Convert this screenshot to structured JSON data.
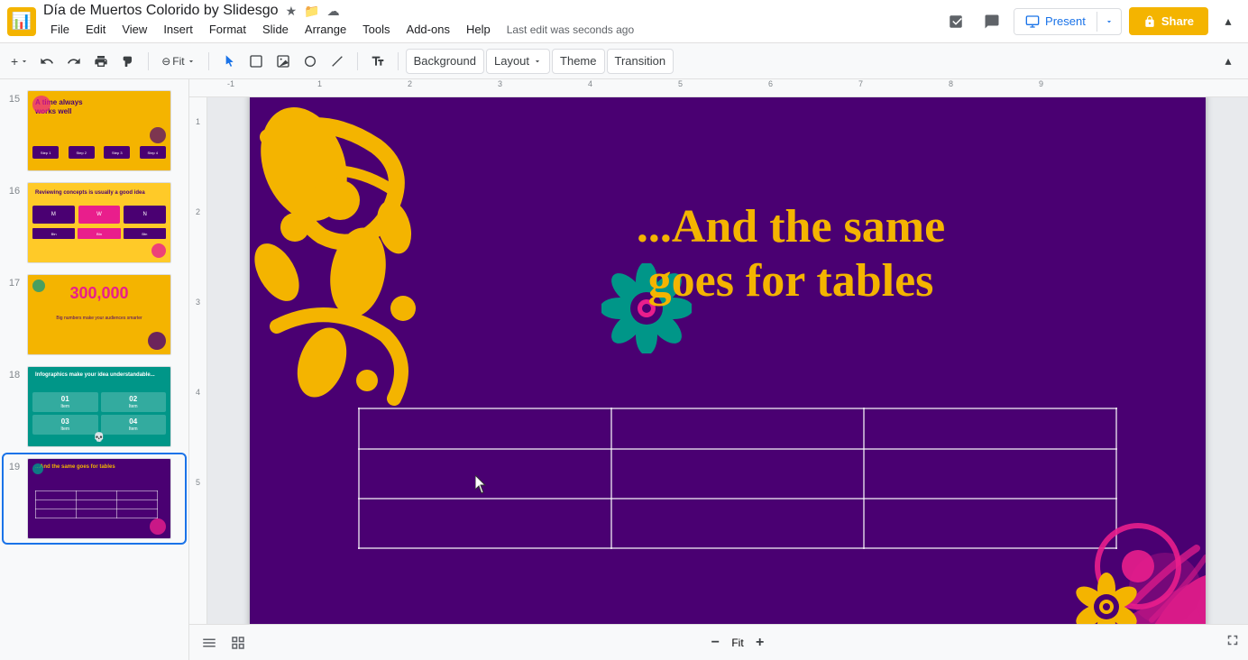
{
  "app": {
    "icon": "📊",
    "title": "Día de Muertos Colorido by Slidesgo",
    "last_edit": "Last edit was seconds ago"
  },
  "menu": {
    "items": [
      "File",
      "Edit",
      "View",
      "Insert",
      "Format",
      "Slide",
      "Arrange",
      "Tools",
      "Add-ons",
      "Help"
    ]
  },
  "toolbar": {
    "background_label": "Background",
    "layout_label": "Layout",
    "theme_label": "Theme",
    "transition_label": "Transition"
  },
  "present": {
    "label": "Present"
  },
  "share": {
    "label": "Share"
  },
  "slides": [
    {
      "num": "15",
      "theme": "teal_yellow"
    },
    {
      "num": "16",
      "theme": "yellow_review"
    },
    {
      "num": "17",
      "theme": "yellow_300"
    },
    {
      "num": "18",
      "theme": "teal_infographic"
    },
    {
      "num": "19",
      "theme": "purple_tables",
      "active": true
    }
  ],
  "slide": {
    "title_line1": "...And the same",
    "title_line2": "goes for tables",
    "bg_color": "#4a0072"
  },
  "ruler": {
    "top_marks": [
      "-1",
      "1",
      "2",
      "3",
      "4",
      "5",
      "6",
      "7",
      "8",
      "9"
    ],
    "left_marks": [
      "1",
      "2",
      "3",
      "4",
      "5"
    ]
  },
  "bottom": {
    "list_view_label": "List view",
    "grid_view_label": "Grid view"
  },
  "colors": {
    "accent_yellow": "#f4b400",
    "accent_purple": "#4a0072",
    "accent_pink": "#e91e8c",
    "accent_teal": "#009688"
  },
  "icons": {
    "star": "★",
    "folder": "📁",
    "cloud": "☁",
    "explore": "↗",
    "comment": "💬",
    "present_monitor": "🖥",
    "lock": "🔒",
    "chevron_down": "▾",
    "chevron_up": "▴",
    "undo": "↩",
    "redo": "↪",
    "print": "🖨",
    "paint": "🎨",
    "zoom_out": "−",
    "zoom_in": "+",
    "list_view": "☰",
    "grid_view": "⊞",
    "collapse": "▴",
    "cursor": "↖",
    "select": "▢",
    "image": "🖼",
    "shape": "○",
    "line": "/",
    "plus": "+",
    "minus": "−",
    "more": "⋮"
  }
}
